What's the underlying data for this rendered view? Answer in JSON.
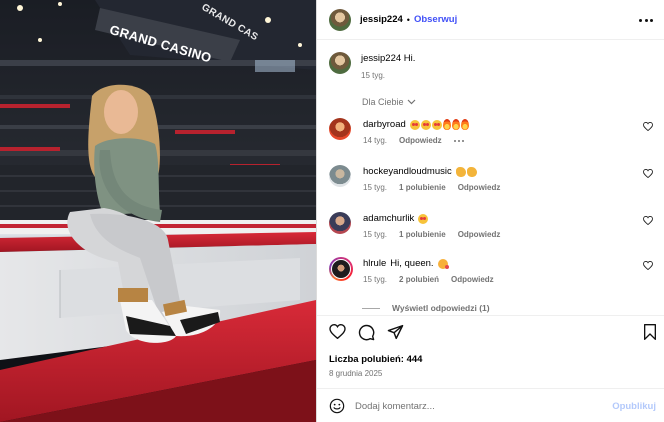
{
  "photo": {
    "banner_main": "GRAND CASINO",
    "banner_top": "GRAND CAS"
  },
  "header": {
    "username": "jessip224",
    "separator": "•",
    "follow_label": "Obserwuj"
  },
  "caption": {
    "username": "jessip224",
    "text": "Hi.",
    "time": "15 tyg."
  },
  "for_you_label": "Dla Ciebie",
  "comments": [
    {
      "username": "darbyroad",
      "text": "",
      "time": "14 tyg.",
      "likes": "",
      "reply": "Odpowiedz"
    },
    {
      "username": "hockeyandloudmusic",
      "text": "",
      "time": "15 tyg.",
      "likes": "1 polubienie",
      "reply": "Odpowiedz"
    },
    {
      "username": "adamchurlik",
      "text": "",
      "time": "15 tyg.",
      "likes": "1 polubienie",
      "reply": "Odpowiedz"
    },
    {
      "username": "hlrule",
      "text": "Hi, queen.",
      "time": "15 tyg.",
      "likes": "2 polubień",
      "reply": "Odpowiedz"
    }
  ],
  "view_replies_label": "Wyświetl odpowiedzi (1)",
  "likes_label": "Liczba polubień: 444",
  "post_date": "8 grudnia 2025",
  "composer": {
    "placeholder": "Dodaj komentarz...",
    "post_label": "Opublikuj"
  },
  "colors": {
    "accent": "#4150f7",
    "muted": "#737373",
    "post_disabled": "#b3c9fb"
  },
  "icons": [
    "more-icon",
    "heart-icon",
    "comment-icon",
    "share-icon",
    "bookmark-icon",
    "emoji-icon",
    "chevron-down-icon"
  ]
}
